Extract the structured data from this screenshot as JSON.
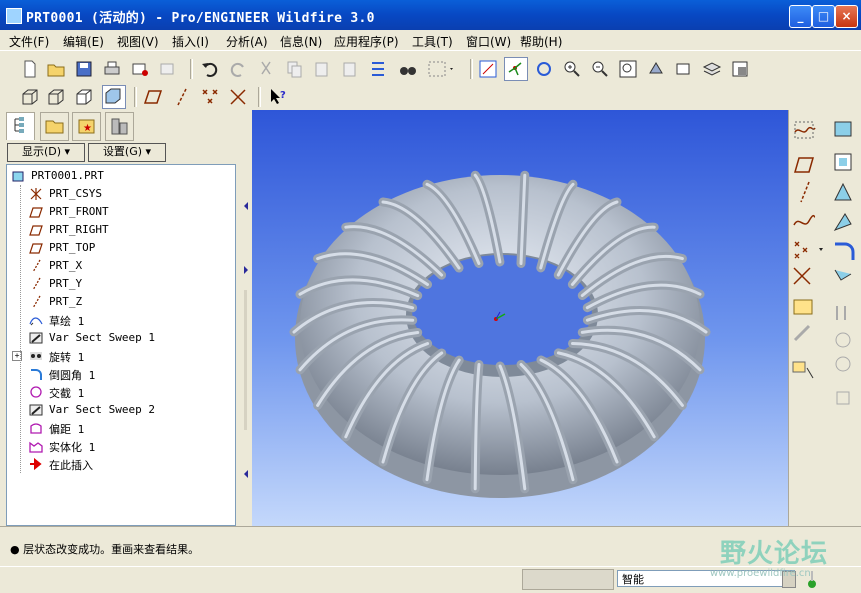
{
  "window": {
    "title": "PRT0001 (活动的) - Pro/ENGINEER Wildfire 3.0",
    "minimize": "_",
    "maximize": "□",
    "close": "×"
  },
  "menu": [
    "文件(F)",
    "编辑(E)",
    "视图(V)",
    "插入(I)",
    "分析(A)",
    "信息(N)",
    "应用程序(P)",
    "工具(T)",
    "窗口(W)",
    "帮助(H)"
  ],
  "panel": {
    "show_label": "显示(D) ▾",
    "settings_label": "设置(G) ▾"
  },
  "tree": [
    {
      "label": "PRT0001.PRT",
      "icon": "part-icon"
    },
    {
      "label": "PRT_CSYS",
      "icon": "csys-icon"
    },
    {
      "label": "PRT_FRONT",
      "icon": "datum-plane-icon"
    },
    {
      "label": "PRT_RIGHT",
      "icon": "datum-plane-icon"
    },
    {
      "label": "PRT_TOP",
      "icon": "datum-plane-icon"
    },
    {
      "label": "PRT_X",
      "icon": "datum-axis-icon"
    },
    {
      "label": "PRT_Y",
      "icon": "datum-axis-icon"
    },
    {
      "label": "PRT_Z",
      "icon": "datum-axis-icon"
    },
    {
      "label": "草绘 1",
      "icon": "sketch-icon"
    },
    {
      "label": "Var Sect Sweep 1",
      "icon": "sweep-icon"
    },
    {
      "label": "旋转 1",
      "icon": "revolve-icon"
    },
    {
      "label": "倒圆角 1",
      "icon": "round-icon"
    },
    {
      "label": "交截 1",
      "icon": "intersect-icon"
    },
    {
      "label": "Var Sect Sweep 2",
      "icon": "sweep-icon"
    },
    {
      "label": "偏距 1",
      "icon": "offset-icon"
    },
    {
      "label": "实体化 1",
      "icon": "solidify-icon"
    },
    {
      "label": "在此插入",
      "icon": "insert-here-icon"
    }
  ],
  "status": {
    "message": "● 层状态改变成功。重画来查看结果。"
  },
  "filter": {
    "value": "智能"
  },
  "watermark": {
    "text": "野火论坛",
    "url": "www.proewildfire.cn"
  }
}
